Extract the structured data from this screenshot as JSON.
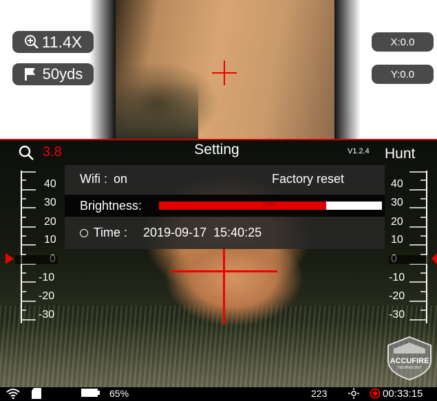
{
  "hud": {
    "zoom_level": "11.4X",
    "distance": "50yds",
    "x_offset": "X:0.0",
    "y_offset": "Y:0.0"
  },
  "settings": {
    "title": "Setting",
    "version": "V1.2.4",
    "mode": "Hunt",
    "zoom_partial": "3.8",
    "wifi_label": "Wifi :",
    "wifi_value": "on",
    "factory_reset_label": "Factory reset",
    "brightness_label": "Brightness:",
    "brightness_value": 0.75,
    "brightness_percent_text": "75%",
    "time_label": "Time :",
    "time_value": "2019-09-17  15:40:25"
  },
  "scale_labels": [
    "40",
    "30",
    "20",
    "10",
    "0",
    "-10",
    "-20",
    "-30"
  ],
  "brand": "ACCUFIRE",
  "brand_sub": "TECHNOLOGY",
  "status": {
    "battery": "65%",
    "counter": "223",
    "recording_time": "00:33:15"
  },
  "icons": [
    "zoom-in-icon",
    "flag-icon",
    "search-icon",
    "wifi-icon",
    "sd-card-icon",
    "battery-icon",
    "brightness-icon",
    "record-icon"
  ],
  "colors": {
    "accent": "#e00000",
    "pill": "#4a4a4a",
    "panel": "#282828"
  }
}
